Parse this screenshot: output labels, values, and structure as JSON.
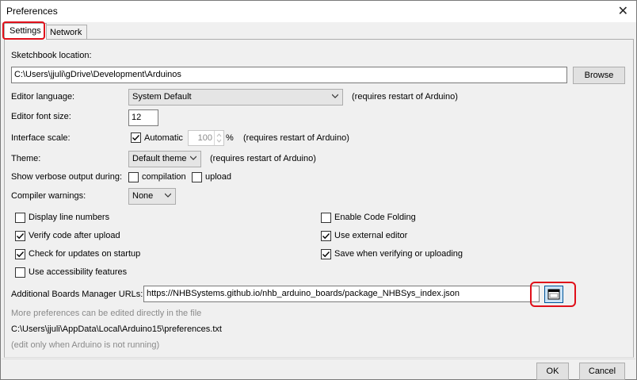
{
  "window": {
    "title": "Preferences",
    "close_glyph": "✕"
  },
  "tabs": [
    {
      "label": "Settings"
    },
    {
      "label": "Network"
    }
  ],
  "sketchbook": {
    "label": "Sketchbook location:",
    "path": "C:\\Users\\jjuli\\gDrive\\Development\\Arduinos",
    "browse_label": "Browse"
  },
  "editor_language": {
    "label": "Editor language:",
    "value": "System Default",
    "note": "(requires restart of Arduino)"
  },
  "font_size": {
    "label": "Editor font size:",
    "value": "12"
  },
  "interface_scale": {
    "label": "Interface scale:",
    "automatic_label": "Automatic",
    "automatic_checked": true,
    "value": "100",
    "unit": "%",
    "note": "(requires restart of Arduino)"
  },
  "theme": {
    "label": "Theme:",
    "value": "Default theme",
    "note": "(requires restart of Arduino)"
  },
  "verbose": {
    "label": "Show verbose output during:",
    "compilation_label": "compilation",
    "compilation_checked": false,
    "upload_label": "upload",
    "upload_checked": false
  },
  "compiler_warnings": {
    "label": "Compiler warnings:",
    "value": "None"
  },
  "options_left": [
    {
      "label": "Display line numbers",
      "checked": false
    },
    {
      "label": "Verify code after upload",
      "checked": true
    },
    {
      "label": "Check for updates on startup",
      "checked": true
    },
    {
      "label": "Use accessibility features",
      "checked": false
    }
  ],
  "options_right": [
    {
      "label": "Enable Code Folding",
      "checked": false
    },
    {
      "label": "Use external editor",
      "checked": true
    },
    {
      "label": "Save when verifying or uploading",
      "checked": true
    }
  ],
  "boards_manager": {
    "label": "Additional Boards Manager URLs:",
    "value": "https://NHBSystems.github.io/nhb_arduino_boards/package_NHBSys_index.json",
    "button_icon": "window-icon"
  },
  "footer": {
    "more_prefs": "More preferences can be edited directly in the file",
    "prefs_path": "C:\\Users\\jjuli\\AppData\\Local\\Arduino15\\preferences.txt",
    "edit_note": "(edit only when Arduino is not running)"
  },
  "buttons": {
    "ok": "OK",
    "cancel": "Cancel"
  },
  "colors": {
    "highlight": "#e0101a",
    "window_bg": "#f0f0f0",
    "button_bg": "#e1e1e1",
    "focused_button_bg": "#cce4f7"
  }
}
